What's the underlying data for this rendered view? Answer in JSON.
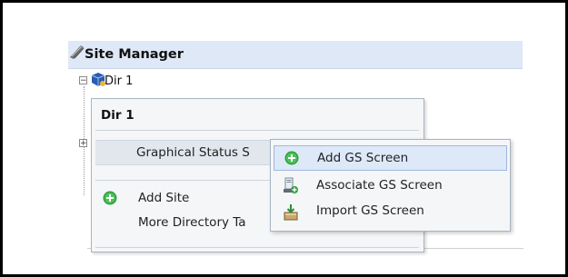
{
  "site_manager": {
    "title": "Site Manager",
    "tree": {
      "dir_label": "Dir 1"
    }
  },
  "context_menu": {
    "title": "Dir 1",
    "items": [
      {
        "label": "Graphical Status S",
        "highlighted": true
      },
      {
        "label": "Add Site",
        "icon": "add-icon"
      },
      {
        "label": "More Directory Ta"
      }
    ]
  },
  "submenu": {
    "items": [
      {
        "label": "Add GS Screen",
        "icon": "add-icon",
        "hover": true
      },
      {
        "label": "Associate GS Screen",
        "icon": "associate-icon"
      },
      {
        "label": "Import GS Screen",
        "icon": "import-icon"
      }
    ]
  },
  "colors": {
    "header_bg": "#dfe8f6",
    "menu_bg": "#f4f6f8",
    "hover_bg": "#dde8f8",
    "add_icon_green": "#2e9e3a"
  }
}
